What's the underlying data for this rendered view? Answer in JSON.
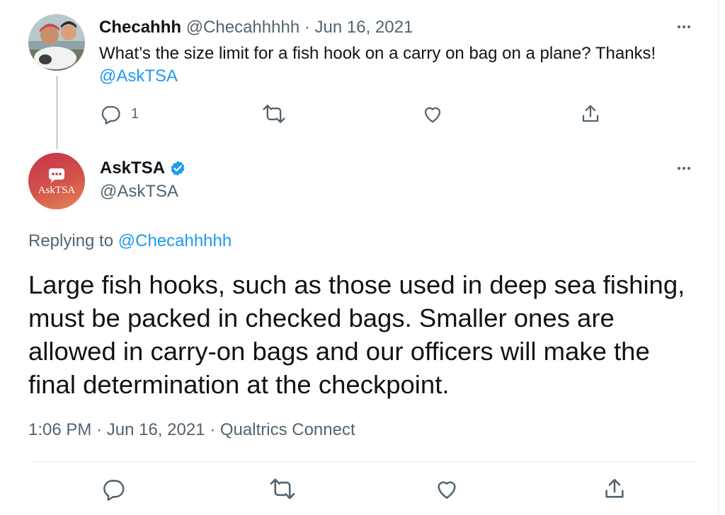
{
  "original_tweet": {
    "display_name": "Checahhh",
    "handle": "@Checahhhhh",
    "separator": "·",
    "date": "Jun 16, 2021",
    "text": "What’s the size limit for a fish hook on a carry on bag on a plane? Thanks!",
    "mention": "@AskTSA",
    "reply_count": "1"
  },
  "reply_tweet": {
    "display_name": "AskTSA",
    "handle": "@AskTSA",
    "avatar_text": "AskTSA",
    "replying_to_label": "Replying to",
    "replying_to_handle": "@Checahhhhh",
    "text": "Large fish hooks, such as those used in deep sea fishing, must be packed in checked bags. Smaller ones are allowed in carry-on bags and our officers will make the final determination at the checkpoint.",
    "time": "1:06 PM",
    "date": "Jun 16, 2021",
    "source": "Qualtrics Connect",
    "meta_separator": "·"
  },
  "colors": {
    "accent": "#1d9bf0",
    "verified": "#1d9bf0",
    "muted_text": "#536471",
    "asktsa_gradient_start": "#c8324a",
    "asktsa_gradient_end": "#e8875a"
  },
  "icons": [
    "more-icon",
    "reply-icon",
    "retweet-icon",
    "like-icon",
    "share-icon",
    "verified-badge-icon",
    "chat-bubble-icon"
  ]
}
